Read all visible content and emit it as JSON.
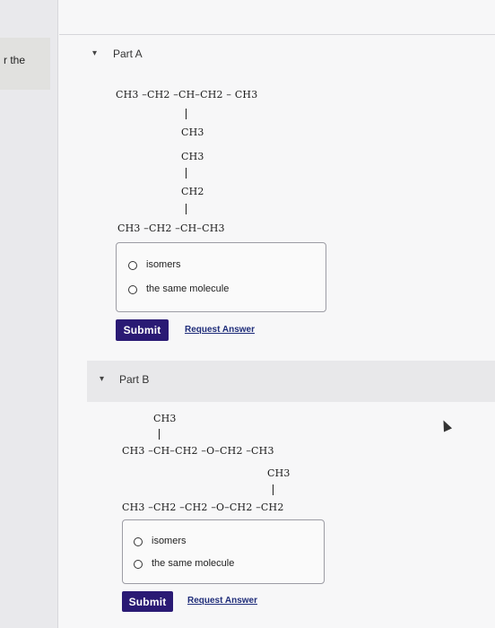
{
  "sidebar": {
    "note_fragment": "r the"
  },
  "part_a": {
    "title": "Part A",
    "structure": {
      "line1": "CH3 –CH2 –CH–CH2 – CH3",
      "ch3_a": "CH3",
      "ch3_b": "CH3",
      "ch2": "CH2",
      "line_bottom": "CH3 –CH2 –CH–CH3"
    },
    "options": [
      "isomers",
      "the same molecule"
    ],
    "submit_label": "Submit",
    "request_label": "Request Answer"
  },
  "part_b": {
    "title": "Part B",
    "structure": {
      "top_ch3": "CH3",
      "line1": "CH3 –CH–CH2 –O–CH2 –CH3",
      "mid_ch3": "CH3",
      "line2": "CH3 –CH2 –CH2 –O–CH2 –CH2"
    },
    "options": [
      "isomers",
      "the same molecule"
    ],
    "submit_label": "Submit",
    "request_label": "Request Answer"
  },
  "icons": {
    "collapse": "caret-down-icon",
    "pointer": "mouse-cursor-icon"
  }
}
